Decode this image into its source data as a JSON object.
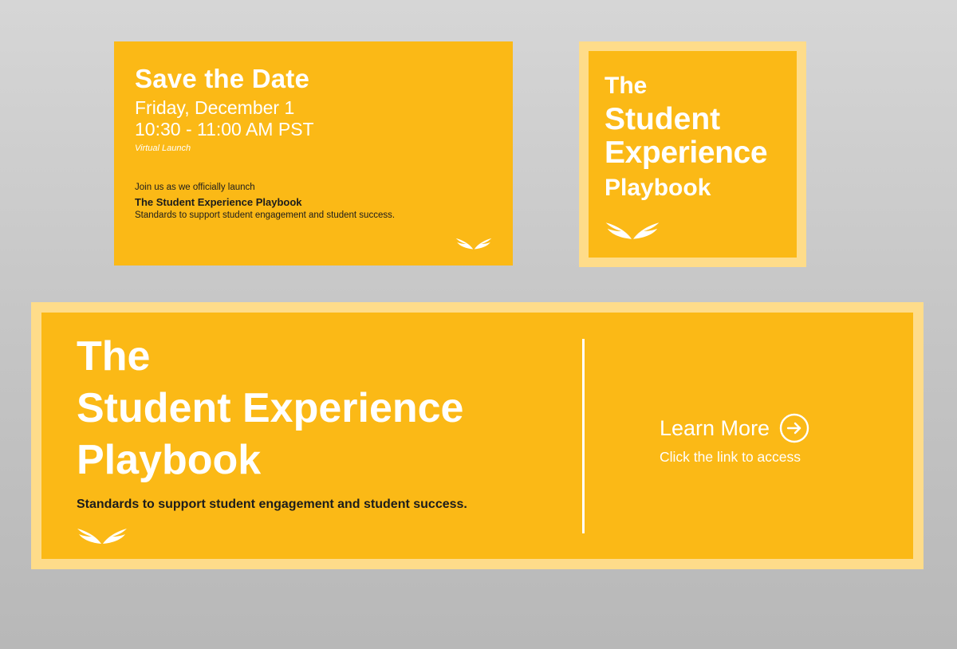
{
  "colors": {
    "background": "#c8c8c8",
    "card_yellow": "#fbb916",
    "card_border": "#fedc8a",
    "text_light": "#ffffff",
    "text_dark": "#1c1c1c"
  },
  "logo_icon": "wings-logo-icon",
  "save_the_date_card": {
    "title": "Save the Date",
    "date": "Friday, December 1",
    "time": "10:30 - 11:00 AM PST",
    "format": "Virtual Launch",
    "invite": "Join us as we officially launch",
    "name": "The Student Experience Playbook",
    "tagline": "Standards to support student engagement and student success."
  },
  "square_card": {
    "line_the": "The",
    "line_1": "Student",
    "line_2": "Experience",
    "line_3": "Playbook"
  },
  "banner_card": {
    "line_the": "The",
    "line_1": "Student Experience",
    "line_2": "Playbook",
    "tagline": "Standards to support student engagement and student success.",
    "cta_label": "Learn More",
    "cta_icon": "arrow-right-circle-icon",
    "cta_sub": "Click the link to access"
  }
}
